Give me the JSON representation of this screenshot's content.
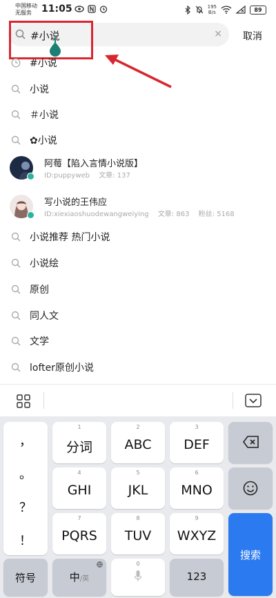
{
  "status": {
    "carrier_line1": "中国移动",
    "carrier_line2": "无服务",
    "time": "11:05",
    "speed_value": "195",
    "speed_unit": "B/s",
    "battery": "89"
  },
  "search": {
    "query": "#小说",
    "cancel_label": "取消",
    "clear_icon": "×"
  },
  "suggestions_top": [
    {
      "icon": "history-icon",
      "text": "#小说"
    },
    {
      "icon": "search-icon",
      "text": "小说"
    },
    {
      "icon": "search-icon",
      "text": "＃小说"
    },
    {
      "icon": "search-icon",
      "text": "✿小说"
    }
  ],
  "users": [
    {
      "name": "阿莓【陷入言情小说版】",
      "id": "ID:puppyweb",
      "articles": "文章: 137",
      "fans": ""
    },
    {
      "name": "写小说的王伟应",
      "id": "ID:xiexiaoshuodewangweiying",
      "articles": "文章: 863",
      "fans": "粉丝: 5168"
    }
  ],
  "suggestions_bottom": [
    {
      "icon": "search-icon",
      "text": "小说推荐 热门小说"
    },
    {
      "icon": "search-icon",
      "text": "小说绘"
    },
    {
      "icon": "search-icon",
      "text": "原创"
    },
    {
      "icon": "search-icon",
      "text": "同人文"
    },
    {
      "icon": "search-icon",
      "text": "文学"
    },
    {
      "icon": "search-icon",
      "text": "lofter原创小说"
    }
  ],
  "keyboard": {
    "punctuation": [
      "，",
      "。",
      "？",
      "！"
    ],
    "row1": [
      {
        "num": "1",
        "label": "分词"
      },
      {
        "num": "2",
        "label": "ABC"
      },
      {
        "num": "3",
        "label": "DEF"
      }
    ],
    "row2": [
      {
        "num": "4",
        "label": "GHI"
      },
      {
        "num": "5",
        "label": "JKL"
      },
      {
        "num": "6",
        "label": "MNO"
      }
    ],
    "row3": [
      {
        "num": "7",
        "label": "PQRS"
      },
      {
        "num": "8",
        "label": "TUV"
      },
      {
        "num": "9",
        "label": "WXYZ"
      }
    ],
    "symbols_label": "符号",
    "lang_main": "中",
    "lang_sub": "/英",
    "space_num": "0",
    "num_label": "123",
    "search_label": "搜索"
  },
  "colors": {
    "accent_blue": "#2b7af0",
    "annotation_red": "#d8262f",
    "verified_teal": "#2ab4a0"
  }
}
